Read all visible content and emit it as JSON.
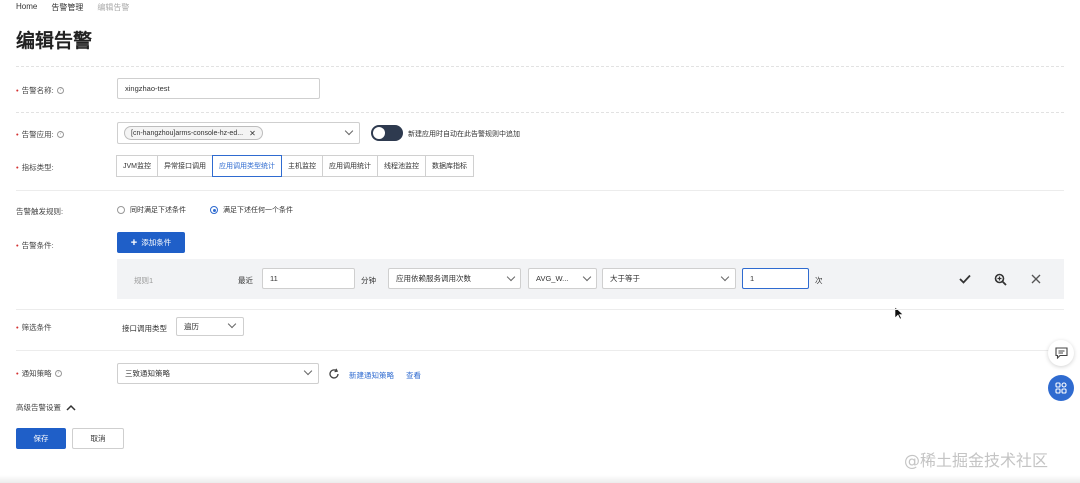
{
  "breadcrumb": {
    "home": "Home",
    "alert_mgmt": "告警管理",
    "current": "编辑告警"
  },
  "page_title": "编辑告警",
  "form": {
    "alert_name": {
      "label": "告警名称:",
      "value": "xingzhao-test"
    },
    "alert_app": {
      "label": "告警应用:",
      "tag": "[cn-hangzhou]arms-console-hz-ed...",
      "toggle_text": "新建应用时自动在此告警规则中追加"
    },
    "metric_type": {
      "label": "指标类型:",
      "tabs": [
        "JVM监控",
        "异常接口调用",
        "应用调用类型统计",
        "主机监控",
        "应用调用统计",
        "线程池监控",
        "数据库指标"
      ],
      "active_index": 2
    },
    "trigger_rule": {
      "label": "告警触发规则:",
      "option_all": "同时满足下述条件",
      "option_any": "满足下述任何一个条件",
      "selected": "any"
    },
    "alert_condition": {
      "label": "告警条件:",
      "add_button": "添加条件",
      "rule": {
        "name": "规则1",
        "recent_label": "最近",
        "minutes_value": "11",
        "minutes_unit": "分钟",
        "metric": "应用依赖服务调用次数",
        "aggregation": "AVG_W...",
        "operator": "大于等于",
        "threshold": "1",
        "unit": "次"
      }
    },
    "filter": {
      "label": "筛选条件",
      "field_label": "接口调用类型",
      "value": "遍历"
    },
    "notify": {
      "label": "通知策略",
      "value": "三致通知策略",
      "new_link": "新建通知策略",
      "view_link": "查看"
    },
    "advanced": {
      "label": "高级告警设置"
    }
  },
  "buttons": {
    "save": "保存",
    "cancel": "取消"
  },
  "watermark": "@稀土掘金技术社区",
  "colors": {
    "primary": "#1f5fc8",
    "toggle_bg": "#2e3a4f",
    "required": "#d43030"
  }
}
